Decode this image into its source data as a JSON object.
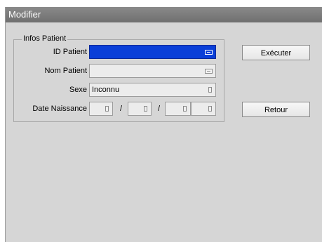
{
  "window": {
    "title": "Modifier"
  },
  "group": {
    "legend": "Infos Patient",
    "fields": {
      "id_patient": {
        "label": "ID Patient",
        "value": ""
      },
      "nom_patient": {
        "label": "Nom Patient",
        "value": ""
      },
      "sexe": {
        "label": "Sexe",
        "value": "Inconnu"
      },
      "date_naissance": {
        "label": "Date Naissance",
        "separator": "/"
      }
    }
  },
  "buttons": {
    "execute": "Exécuter",
    "back": "Retour"
  },
  "icons": {
    "keyboard": "keyboard-icon",
    "list": "list-icon"
  },
  "colors": {
    "active_field": "#0a3fd8",
    "titlebar": "#7a7a7a",
    "background": "#d6d6d6"
  }
}
